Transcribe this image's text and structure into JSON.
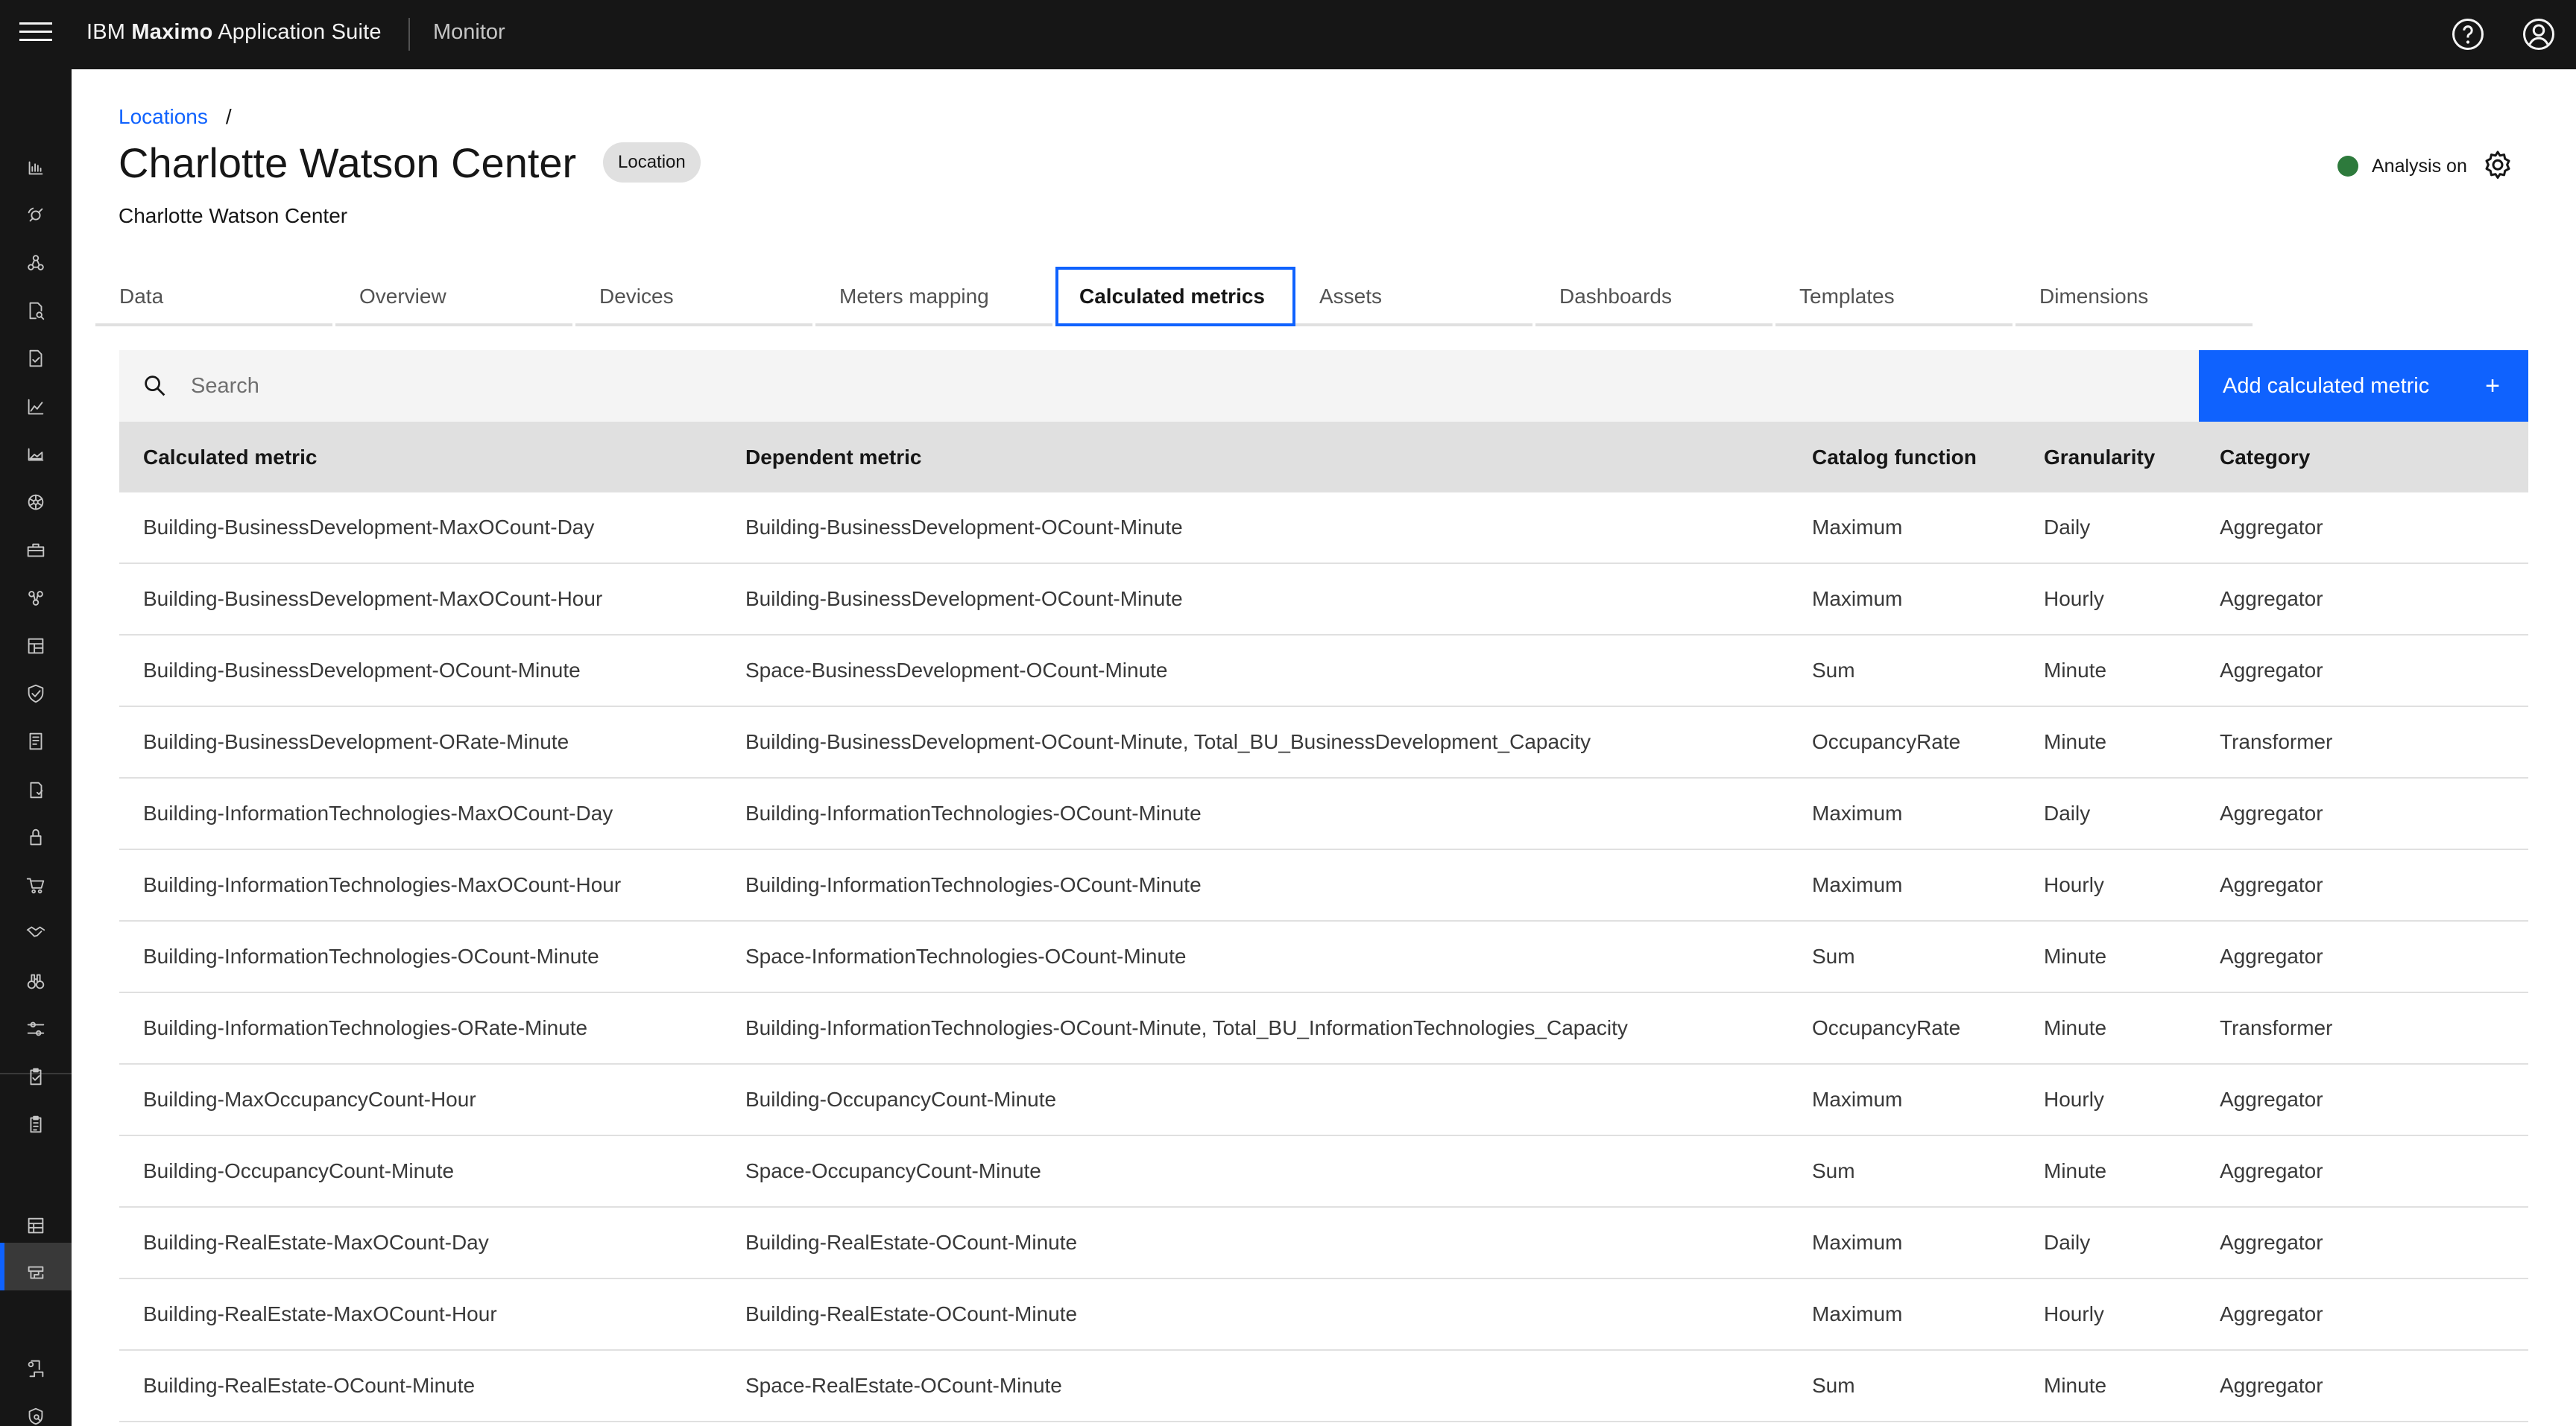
{
  "header": {
    "brand_prefix": "IBM ",
    "brand_bold": "Maximo",
    "brand_suffix": " Application Suite",
    "app_name": "Monitor",
    "icons": [
      "menu-icon",
      "help-icon",
      "user-avatar-icon"
    ]
  },
  "siderail": {
    "icons": [
      "analytics-icon",
      "satellite-icon",
      "hierarchy-icon",
      "document-search-icon",
      "document-task-icon",
      "chart-line-icon",
      "chart-area-icon",
      "network-icon",
      "toolbox-icon",
      "flow-icon",
      "dashboard-icon",
      "security-icon",
      "report-icon",
      "checklist-icon",
      "lock-icon",
      "cart-icon",
      "handshake-icon",
      "binoculars-icon",
      "sliders-icon",
      "clipboard-check-icon",
      "clipboard-icon",
      "catalog-icon",
      "data-structure-icon",
      "document-connect-icon",
      "shield-search-icon",
      "settings-icon"
    ],
    "active_item": "data-structure-icon"
  },
  "breadcrumb": {
    "items": [
      "Locations"
    ],
    "separator": "/"
  },
  "page": {
    "title": "Charlotte Watson Center",
    "tag": "Location",
    "subtitle": "Charlotte Watson Center",
    "analysis_status": "Analysis on",
    "status_color": "#2d7a3c"
  },
  "tabs": [
    {
      "label": "Data"
    },
    {
      "label": "Overview"
    },
    {
      "label": "Devices"
    },
    {
      "label": "Meters mapping"
    },
    {
      "label": "Calculated metrics",
      "active": true
    },
    {
      "label": "Assets"
    },
    {
      "label": "Dashboards"
    },
    {
      "label": "Templates"
    },
    {
      "label": "Dimensions"
    }
  ],
  "toolbar": {
    "search_placeholder": "Search",
    "add_label": "Add calculated metric",
    "add_icon": "+",
    "accent": "#0f62fe"
  },
  "table": {
    "columns": [
      "Calculated metric",
      "Dependent metric",
      "Catalog function",
      "Granularity",
      "Category"
    ],
    "rows": [
      [
        "Building-BusinessDevelopment-MaxOCount-Day",
        "Building-BusinessDevelopment-OCount-Minute",
        "Maximum",
        "Daily",
        "Aggregator"
      ],
      [
        "Building-BusinessDevelopment-MaxOCount-Hour",
        "Building-BusinessDevelopment-OCount-Minute",
        "Maximum",
        "Hourly",
        "Aggregator"
      ],
      [
        "Building-BusinessDevelopment-OCount-Minute",
        "Space-BusinessDevelopment-OCount-Minute",
        "Sum",
        "Minute",
        "Aggregator"
      ],
      [
        "Building-BusinessDevelopment-ORate-Minute",
        "Building-BusinessDevelopment-OCount-Minute, Total_BU_BusinessDevelopment_Capacity",
        "OccupancyRate",
        "Minute",
        "Transformer"
      ],
      [
        "Building-InformationTechnologies-MaxOCount-Day",
        "Building-InformationTechnologies-OCount-Minute",
        "Maximum",
        "Daily",
        "Aggregator"
      ],
      [
        "Building-InformationTechnologies-MaxOCount-Hour",
        "Building-InformationTechnologies-OCount-Minute",
        "Maximum",
        "Hourly",
        "Aggregator"
      ],
      [
        "Building-InformationTechnologies-OCount-Minute",
        "Space-InformationTechnologies-OCount-Minute",
        "Sum",
        "Minute",
        "Aggregator"
      ],
      [
        "Building-InformationTechnologies-ORate-Minute",
        "Building-InformationTechnologies-OCount-Minute, Total_BU_InformationTechnologies_Capacity",
        "OccupancyRate",
        "Minute",
        "Transformer"
      ],
      [
        "Building-MaxOccupancyCount-Hour",
        "Building-OccupancyCount-Minute",
        "Maximum",
        "Hourly",
        "Aggregator"
      ],
      [
        "Building-OccupancyCount-Minute",
        "Space-OccupancyCount-Minute",
        "Sum",
        "Minute",
        "Aggregator"
      ],
      [
        "Building-RealEstate-MaxOCount-Day",
        "Building-RealEstate-OCount-Minute",
        "Maximum",
        "Daily",
        "Aggregator"
      ],
      [
        "Building-RealEstate-MaxOCount-Hour",
        "Building-RealEstate-OCount-Minute",
        "Maximum",
        "Hourly",
        "Aggregator"
      ],
      [
        "Building-RealEstate-OCount-Minute",
        "Space-RealEstate-OCount-Minute",
        "Sum",
        "Minute",
        "Aggregator"
      ]
    ]
  }
}
